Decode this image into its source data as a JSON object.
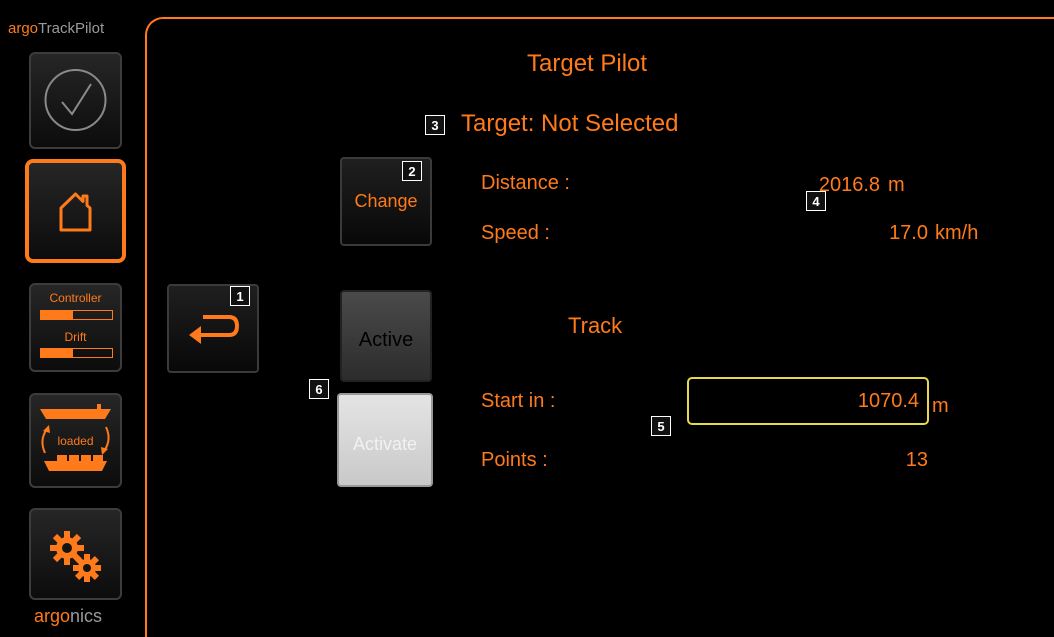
{
  "brand": {
    "top_accent": "argo",
    "top_rest": "TrackPilot",
    "bottom_accent": "argo",
    "bottom_rest": "nics"
  },
  "sidebar": {
    "items": [
      {
        "name": "status",
        "icon": "check-circle-icon",
        "selected": false
      },
      {
        "name": "home",
        "icon": "home-icon",
        "selected": true
      },
      {
        "name": "controller-drift",
        "label_top": "Controller",
        "label_bottom": "Drift",
        "controller_level": 0.45,
        "drift_level": 0.45,
        "selected": false
      },
      {
        "name": "load-state",
        "label": "loaded",
        "icon": "ship-loaded-icon",
        "selected": false
      },
      {
        "name": "settings",
        "icon": "gears-icon",
        "selected": false
      }
    ]
  },
  "main": {
    "title": "Target Pilot",
    "target_status": "Target: Not Selected",
    "change_button": "Change",
    "back_icon": "return-arrow-icon",
    "active_button": "Active",
    "activate_button": "Activate",
    "distance": {
      "label": "Distance :",
      "value": "2016.8",
      "unit": "m"
    },
    "speed": {
      "label": "Speed :",
      "value": "17.0",
      "unit": "km/h"
    },
    "track_title": "Track",
    "start_in": {
      "label": "Start in :",
      "value": "1070.4",
      "unit": "m"
    },
    "points": {
      "label": "Points :",
      "value": "13"
    }
  },
  "callouts": [
    "1",
    "2",
    "3",
    "4",
    "5",
    "6"
  ],
  "colors": {
    "accent": "#ff7a1a",
    "highlight_border": "#e8d84a",
    "muted": "#9a9a9a"
  }
}
